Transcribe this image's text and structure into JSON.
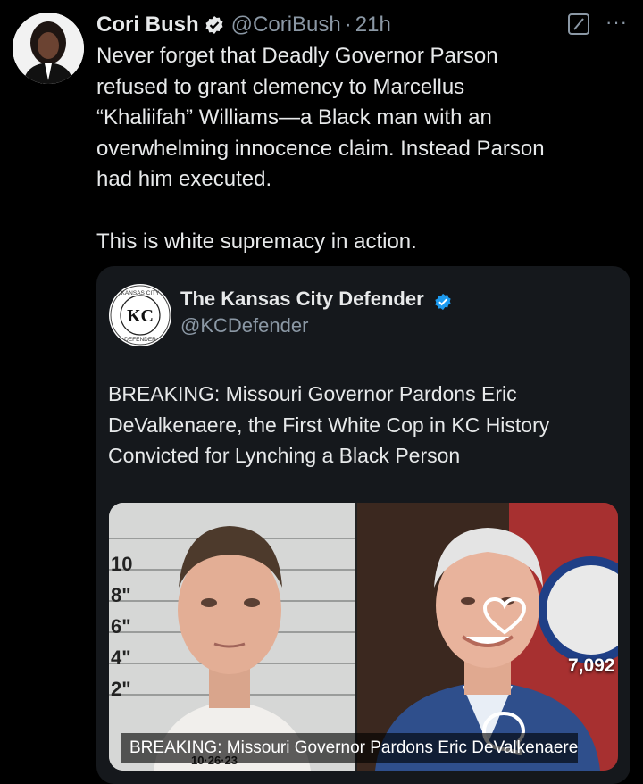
{
  "author": {
    "name": "Cori Bush",
    "handle": "@CoriBush",
    "separator": "·",
    "time": "21h"
  },
  "tweet": {
    "text_1": "Never forget that Deadly Governor Parson\nrefused to grant clemency to Marcellus\n“Khaliifah” Williams—a Black man with an\noverwhelming innocence claim. Instead Parson\nhad him executed.",
    "text_2": "This is white supremacy in action."
  },
  "quoted": {
    "name": "The Kansas City Defender",
    "handle": "@KCDefender",
    "logo_text": "KC",
    "logo_ring_top": "KANSAS CITY",
    "logo_ring_bottom": "DEFENDER",
    "text": "BREAKING: Missouri Governor Pardons Eric DeValkenaere, the First White Cop in KC History Convicted for Lynching a Black Person",
    "media": {
      "mugshot_scale": [
        "10",
        "8\"",
        "6\"",
        "4\"",
        "2\""
      ],
      "mugshot_date": "10·26·23",
      "caption": "BREAKING: Missouri Governor Pardons Eric DeValkenaere,..."
    }
  },
  "actions": {
    "like_count": "7,092"
  },
  "colors": {
    "verified": "#1d9bf0",
    "background": "#000000",
    "card": "#15181c",
    "muted_text": "#8b98a5"
  },
  "icons": [
    "verified-badge-icon",
    "grok-icon",
    "more-icon",
    "heart-icon",
    "comment-icon"
  ]
}
